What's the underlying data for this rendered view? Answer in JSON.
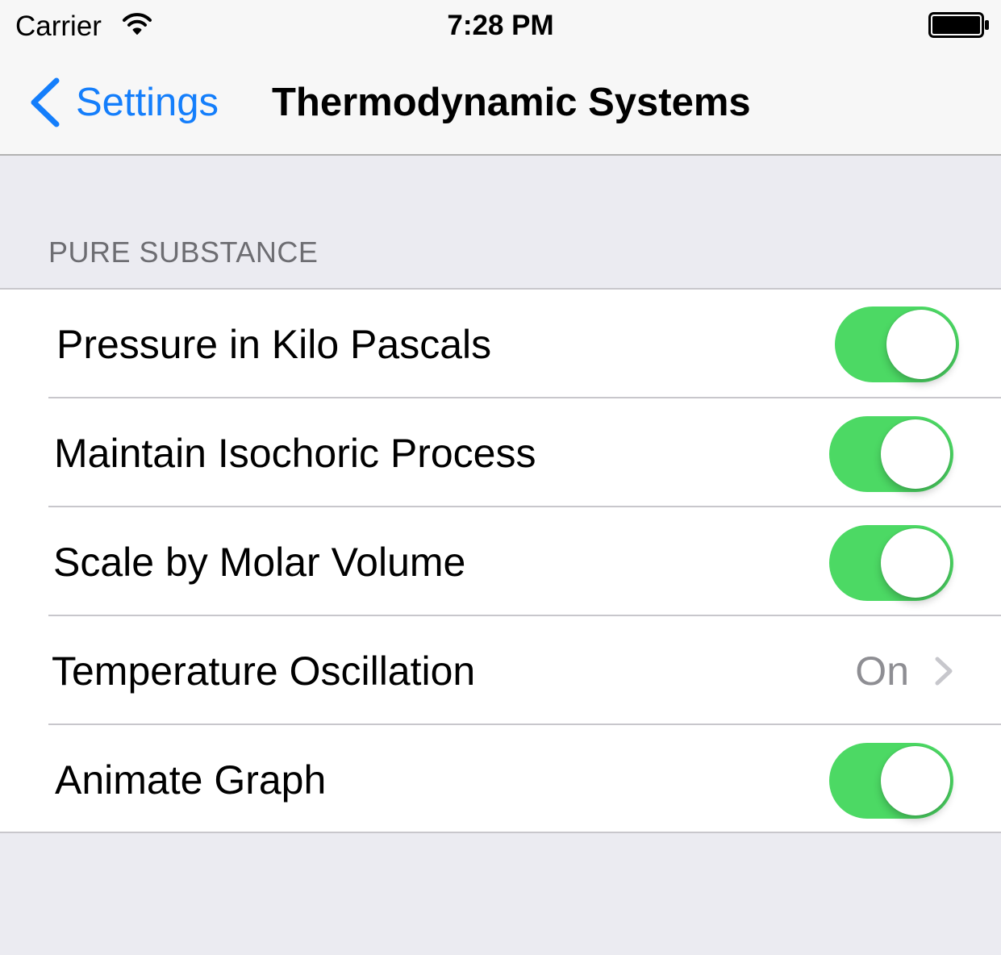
{
  "status_bar": {
    "carrier": "Carrier",
    "time": "7:28 PM"
  },
  "nav": {
    "back_label": "Settings",
    "title": "Thermodynamic Systems"
  },
  "section": {
    "header": "PURE SUBSTANCE",
    "rows": [
      {
        "label": "Pressure in Kilo Pascals",
        "type": "switch",
        "on": true
      },
      {
        "label": "Maintain Isochoric Process",
        "type": "switch",
        "on": true
      },
      {
        "label": "Scale by Molar Volume",
        "type": "switch",
        "on": true
      },
      {
        "label": "Temperature Oscillation",
        "type": "disclosure",
        "value": "On"
      },
      {
        "label": "Animate Graph",
        "type": "switch",
        "on": true
      }
    ]
  },
  "colors": {
    "accent": "#147efb",
    "switch_on": "#4cd964",
    "background": "#ebebf1"
  },
  "icons": [
    "wifi-icon",
    "battery-icon",
    "chevron-left-icon",
    "chevron-right-icon"
  ]
}
